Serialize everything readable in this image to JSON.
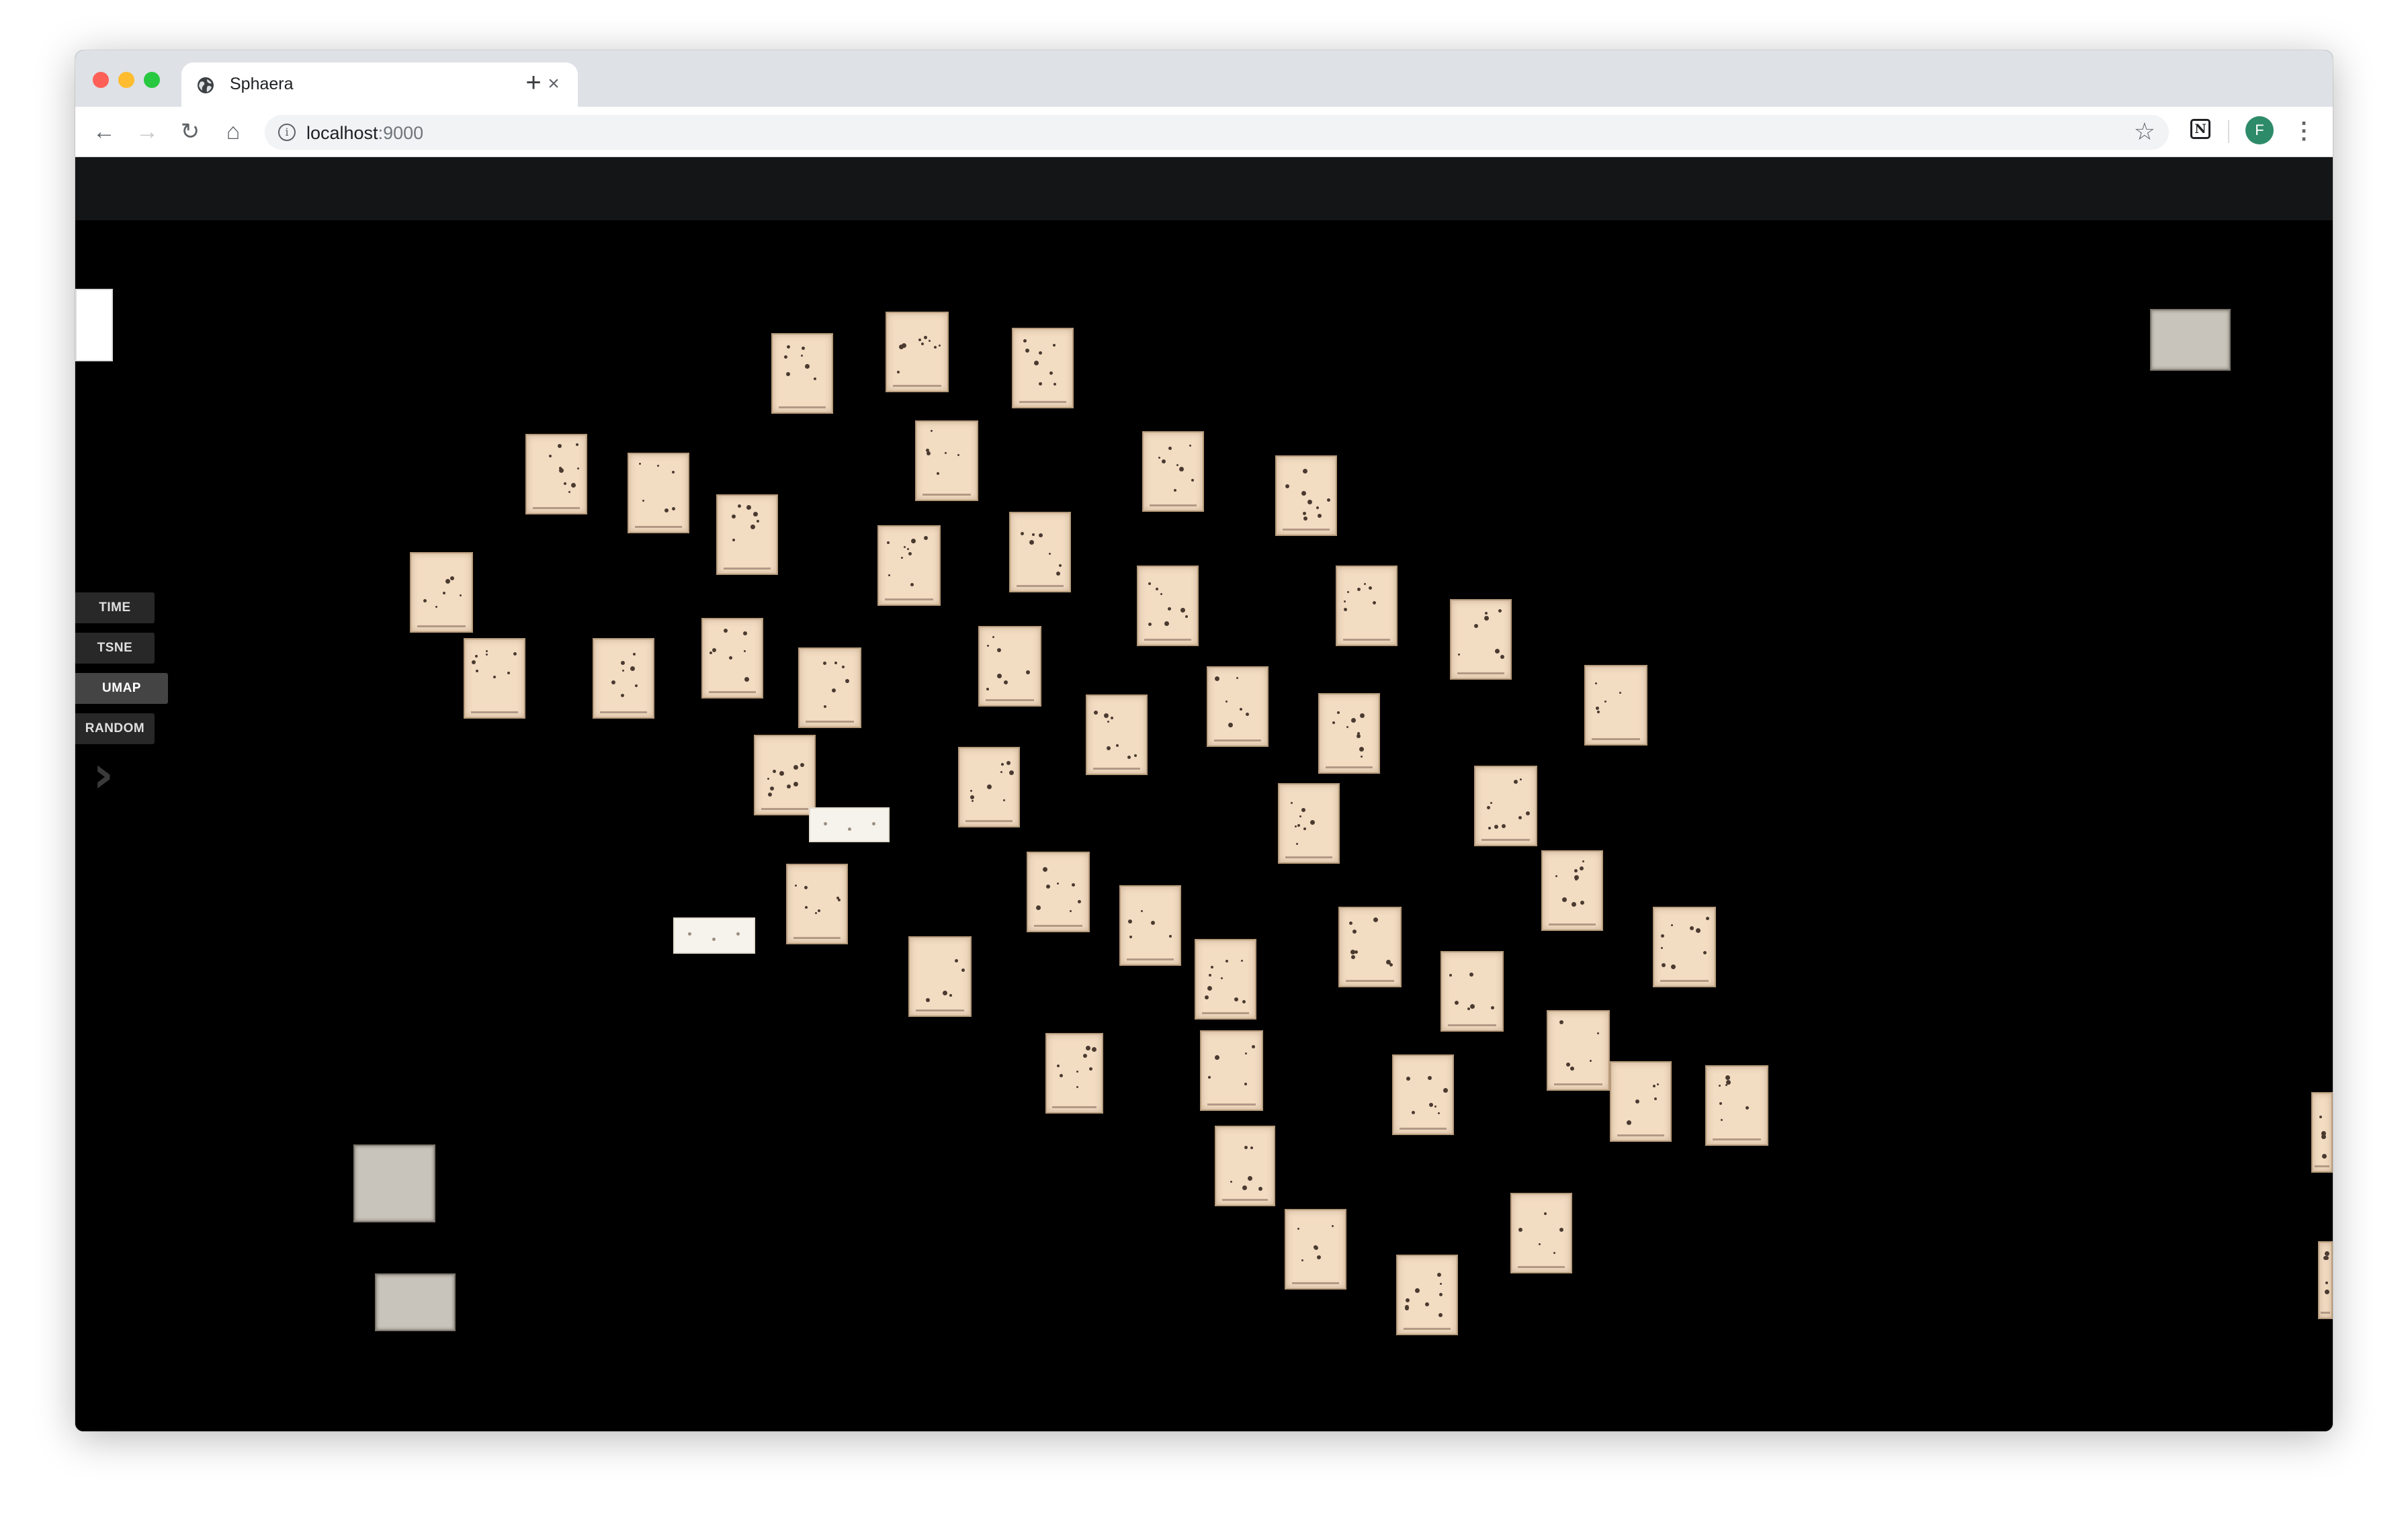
{
  "browser": {
    "tab_title": "Sphaera",
    "tab_close": "×",
    "new_tab": "+",
    "url_host": "localhost",
    "url_port": ":9000",
    "info_glyph": "i",
    "star_glyph": "☆",
    "back_glyph": "←",
    "forward_glyph": "→",
    "reload_glyph": "↻",
    "home_glyph": "⌂",
    "notion_glyph": "N",
    "avatar_letter": "F",
    "menu_glyph": "⋮"
  },
  "app": {
    "layouts": [
      {
        "label": "TIME",
        "active": false
      },
      {
        "label": "TSNE",
        "active": false
      },
      {
        "label": "UMAP",
        "active": true
      },
      {
        "label": "RANDOM",
        "active": false
      }
    ],
    "next_glyph": "›",
    "accent_colors": {
      "card_paper": "#f2dcc2",
      "card_border": "#b79b7b",
      "header_bg": "#141517",
      "button_bg": "#282828",
      "button_active_bg": "#444444"
    }
  }
}
